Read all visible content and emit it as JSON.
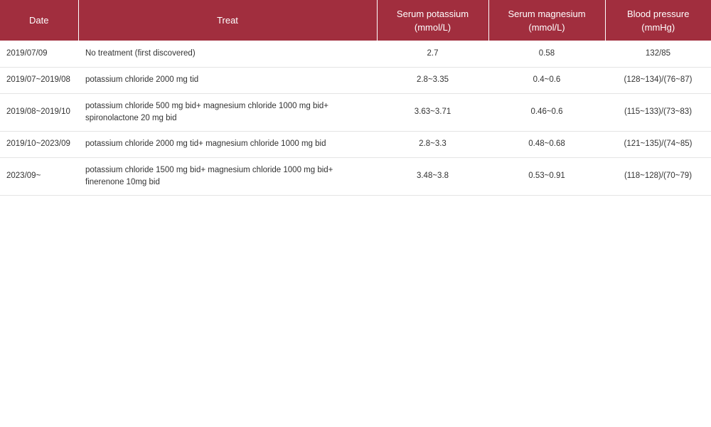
{
  "table": {
    "headers": [
      {
        "line1": "Date",
        "line2": ""
      },
      {
        "line1": "Treat",
        "line2": ""
      },
      {
        "line1": "Serum potassium",
        "line2": "(mmol/L)"
      },
      {
        "line1": "Serum magnesium",
        "line2": "(mmol/L)"
      },
      {
        "line1": "Blood pressure",
        "line2": "(mmHg)"
      }
    ],
    "rows": [
      {
        "date": "2019/07/09",
        "treat_line1": "No treatment (first discovered)",
        "treat_line2": "",
        "potassium": "2.7",
        "magnesium": "0.58",
        "blood_pressure": "132/85"
      },
      {
        "date": "2019/07~2019/08",
        "treat_line1": "potassium chloride 2000 mg tid",
        "treat_line2": "",
        "potassium": "2.8~3.35",
        "magnesium": "0.4~0.6",
        "blood_pressure": "(128~134)/(76~87)"
      },
      {
        "date": "2019/08~2019/10",
        "treat_line1": "potassium chloride 500 mg bid+ magnesium chloride 1000 mg bid+",
        "treat_line2": "spironolactone 20 mg bid",
        "potassium": "3.63~3.71",
        "magnesium": "0.46~0.6",
        "blood_pressure": "(115~133)/(73~83)"
      },
      {
        "date": "2019/10~2023/09",
        "treat_line1": "potassium chloride 2000 mg tid+ magnesium chloride 1000 mg bid",
        "treat_line2": "",
        "potassium": "2.8~3.3",
        "magnesium": "0.48~0.68",
        "blood_pressure": "(121~135)/(74~85)"
      },
      {
        "date": "2023/09~",
        "treat_line1": "potassium chloride 1500 mg bid+ magnesium chloride 1000 mg bid+",
        "treat_line2": "finerenone 10mg bid",
        "potassium": "3.48~3.8",
        "magnesium": "0.53~0.91",
        "blood_pressure": "(118~128)/(70~79)"
      }
    ]
  },
  "colors": {
    "header_background": "#a12e3e",
    "header_text": "#ffffff",
    "row_divider": "#e4e4e4"
  }
}
